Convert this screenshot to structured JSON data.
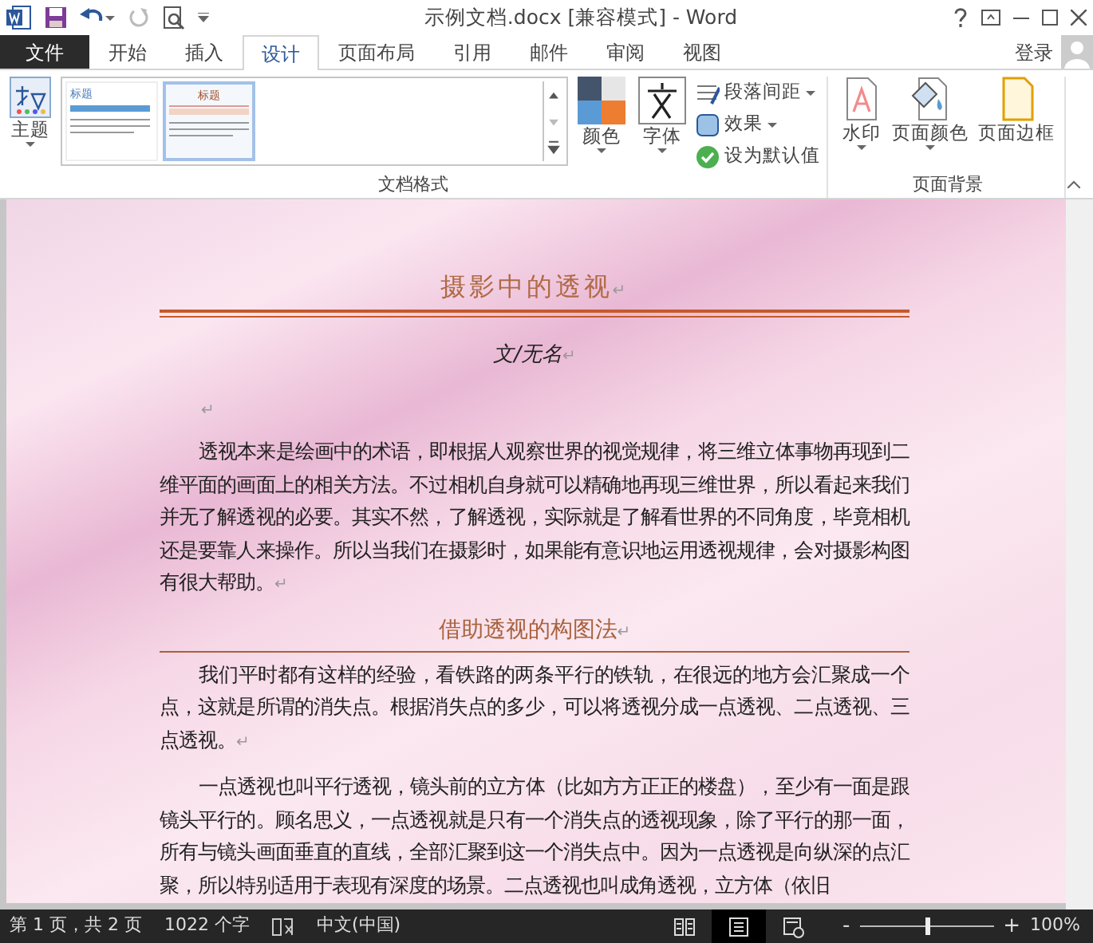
{
  "title_bar": {
    "title": "示例文档.docx [兼容模式] - Word",
    "redo_disabled": true
  },
  "tabs": [
    {
      "label": "文件",
      "kind": "file",
      "selected": false
    },
    {
      "label": "开始",
      "kind": "tab",
      "selected": false
    },
    {
      "label": "插入",
      "kind": "tab",
      "selected": false
    },
    {
      "label": "设计",
      "kind": "tab",
      "selected": true
    },
    {
      "label": "页面布局",
      "kind": "tab",
      "selected": false
    },
    {
      "label": "引用",
      "kind": "tab",
      "selected": false
    },
    {
      "label": "邮件",
      "kind": "tab",
      "selected": false
    },
    {
      "label": "审阅",
      "kind": "tab",
      "selected": false
    },
    {
      "label": "视图",
      "kind": "tab",
      "selected": false
    }
  ],
  "account": {
    "label": "登录"
  },
  "ribbon": {
    "document_format": {
      "label": "文档格式",
      "theme": {
        "label": "主题"
      },
      "gallery": [
        {
          "heading": "标题",
          "selected": false
        },
        {
          "heading": "标题",
          "selected": true
        }
      ],
      "colors": {
        "label": "颜色"
      },
      "fonts": {
        "label": "字体"
      },
      "small_buttons": [
        {
          "kind": "spacing",
          "label": "段落间距",
          "dropdown": true
        },
        {
          "kind": "effects",
          "label": "效果",
          "dropdown": true
        },
        {
          "kind": "default",
          "label": "设为默认值",
          "dropdown": false
        }
      ]
    },
    "page_background": {
      "label": "页面背景",
      "buttons": [
        {
          "kind": "watermark",
          "label": "水印",
          "dropdown": true
        },
        {
          "kind": "page_color",
          "label": "页面颜色",
          "dropdown": true
        },
        {
          "kind": "page_border",
          "label": "页面边框",
          "dropdown": false
        }
      ]
    }
  },
  "document": {
    "blocks": [
      {
        "kind": "title",
        "text": "摄影中的透视",
        "mark": "↵"
      },
      {
        "kind": "byline",
        "text": "文/无名",
        "mark": "↵"
      },
      {
        "kind": "empty",
        "mark": "↵"
      },
      {
        "kind": "para",
        "text": "透视本来是绘画中的术语，即根据人观察世界的视觉规律，将三维立体事物再现到二维平面的画面上的相关方法。不过相机自身就可以精确地再现三维世界，所以看起来我们并无了解透视的必要。其实不然，了解透视，实际就是了解看世界的不同角度，毕竟相机还是要靠人来操作。所以当我们在摄影时，如果能有意识地运用透视规律，会对摄影构图有很大帮助。",
        "mark": "↵"
      },
      {
        "kind": "heading",
        "text": "借助透视的构图法",
        "mark": "↵"
      },
      {
        "kind": "para",
        "text": "我们平时都有这样的经验，看铁路的两条平行的铁轨，在很远的地方会汇聚成一个点，这就是所谓的消失点。根据消失点的多少，可以将透视分成一点透视、二点透视、三点透视。",
        "mark": "↵"
      },
      {
        "kind": "para",
        "text": "一点透视也叫平行透视，镜头前的立方体（比如方方正正的楼盘），至少有一面是跟镜头平行的。顾名思义，一点透视就是只有一个消失点的透视现象，除了平行的那一面，所有与镜头画面垂直的直线，全部汇聚到这一个消失点中。因为一点透视是向纵深的点汇聚，所以特别适用于表现有深度的场景。二点透视也叫成角透视，立方体（依旧"
      }
    ]
  },
  "status_bar": {
    "page": "第 1 页，共 2 页",
    "words": "1022 个字",
    "language": "中文(中国)",
    "views": [
      {
        "kind": "read",
        "selected": false
      },
      {
        "kind": "print",
        "selected": true
      },
      {
        "kind": "web",
        "selected": false
      }
    ],
    "zoom": {
      "minus": "-",
      "plus": "+",
      "level": 0.5,
      "reading": "100%"
    }
  }
}
